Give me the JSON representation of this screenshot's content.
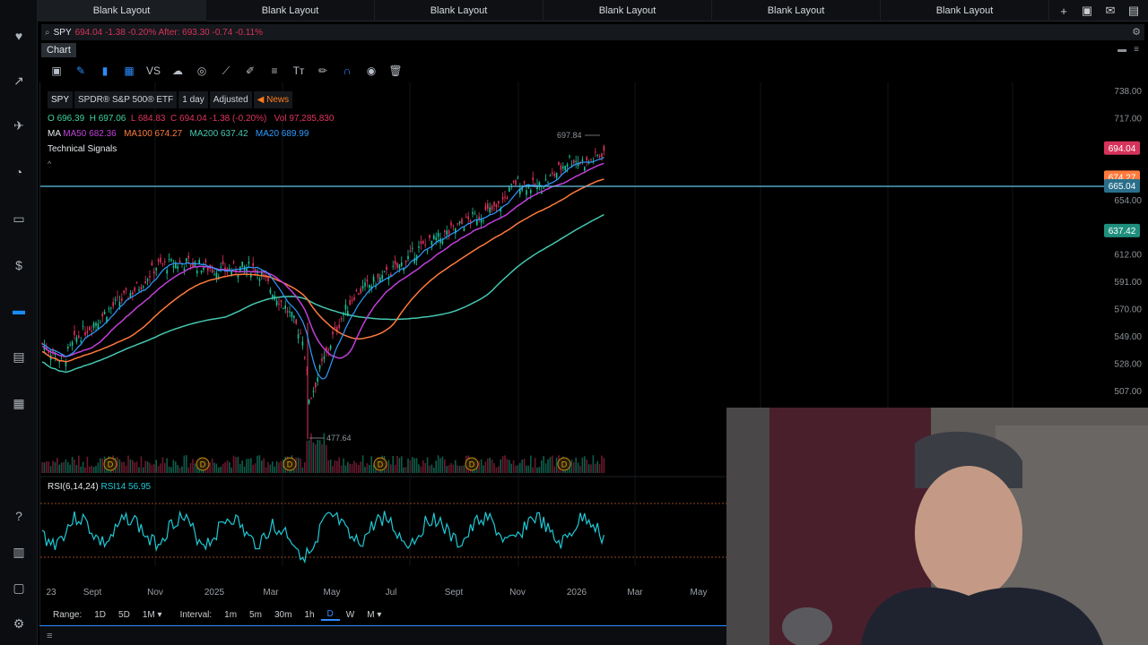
{
  "tabs": [
    "Blank Layout",
    "Blank Layout",
    "Blank Layout",
    "Blank Layout",
    "Blank Layout",
    "Blank Layout"
  ],
  "symbol_bar": {
    "symbol": "SPY",
    "quote": "694.04 -1.38 -0.20% After: 693.30 -0.74 -0.11%"
  },
  "chart_tab": "Chart",
  "info": {
    "symbol": "SPY",
    "description": "SPDR® S&P 500® ETF",
    "period": "1 day",
    "adjusted": "Adjusted",
    "news": "News",
    "ohlc": {
      "o_label": "O",
      "o": "696.39",
      "h_label": "H",
      "h": "697.06",
      "l_label": "L",
      "l": "684.83",
      "c_label": "C",
      "c": "694.04 -1.38 (-0.20%)",
      "vol_label": "Vol",
      "vol": "97,285,830"
    },
    "ma_label": "MA",
    "ma50": "MA50 682.36",
    "ma100": "MA100 674.27",
    "ma200": "MA200 637.42",
    "ma20": "MA20 689.99",
    "signals": "Technical Signals"
  },
  "rsi_label": "RSI(6,14,24)",
  "rsi_value": "RSI14 56.95",
  "price_axis": [
    "738.00",
    "717.00",
    "654.00",
    "612.00",
    "591.00",
    "570.00",
    "549.00",
    "528.00",
    "507.00"
  ],
  "price_tags": {
    "last": "694.04",
    "ma100": "674.27",
    "hline": "665.04",
    "ma200": "637.42"
  },
  "annotations": {
    "high": "697.84",
    "low": "477.64"
  },
  "dividend_marker": "D",
  "time_axis": [
    "23",
    "Sept",
    "Nov",
    "2025",
    "Mar",
    "May",
    "Jul",
    "Sept",
    "Nov",
    "2026",
    "Mar",
    "May"
  ],
  "bottom": {
    "range_label": "Range:",
    "ranges": [
      "1D",
      "5D",
      "1M"
    ],
    "interval_label": "Interval:",
    "intervals": [
      "1m",
      "5m",
      "30m",
      "1h",
      "D",
      "W",
      "M"
    ]
  },
  "colors": {
    "ma50": "#c040d8",
    "ma100": "#ff7a3c",
    "ma200": "#45c7b0",
    "ma20": "#2f9bff",
    "up": "#19c39a",
    "down": "#e0335e",
    "rsi": "#1ec9d6",
    "hline": "#5fc3e4"
  }
}
